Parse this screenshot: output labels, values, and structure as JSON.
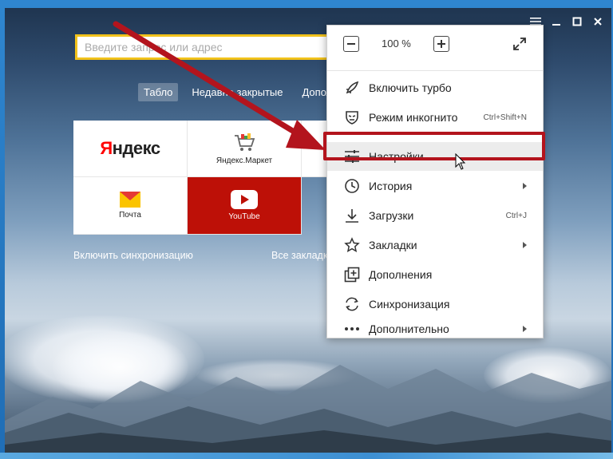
{
  "search": {
    "placeholder": "Введите запрос или адрес"
  },
  "tabs": [
    {
      "label": "Табло",
      "active": true
    },
    {
      "label": "Недавно закрытые",
      "active": false
    },
    {
      "label": "Дополнения",
      "active": false
    }
  ],
  "tiles": [
    {
      "label": "Яндекс",
      "kind": "logo"
    },
    {
      "label": "Яндекс.Маркет",
      "kind": "market"
    },
    {
      "label": "Почта",
      "kind": "mail"
    },
    {
      "label": "YouTube",
      "kind": "youtube"
    }
  ],
  "links": {
    "sync": "Включить синхронизацию",
    "all_bookmarks": "Все закладки"
  },
  "menu": {
    "zoom": {
      "value": "100 %",
      "minus_icon": "minus-icon",
      "plus_icon": "plus-icon",
      "fullscreen_icon": "fullscreen-icon"
    },
    "items": [
      {
        "label": "Включить турбо",
        "icon": "rocket-icon",
        "shortcut": "",
        "submenu": false
      },
      {
        "label": "Режим инкогнито",
        "icon": "incognito-mask-icon",
        "shortcut": "Ctrl+Shift+N",
        "submenu": false
      },
      {
        "label": "Настройки",
        "icon": "settings-sliders-icon",
        "shortcut": "",
        "submenu": false,
        "highlighted": true
      },
      {
        "label": "История",
        "icon": "clock-icon",
        "shortcut": "",
        "submenu": true
      },
      {
        "label": "Загрузки",
        "icon": "download-icon",
        "shortcut": "Ctrl+J",
        "submenu": false
      },
      {
        "label": "Закладки",
        "icon": "star-icon",
        "shortcut": "",
        "submenu": true
      },
      {
        "label": "Дополнения",
        "icon": "extensions-icon",
        "shortcut": "",
        "submenu": false
      },
      {
        "label": "Синхронизация",
        "icon": "sync-icon",
        "shortcut": "",
        "submenu": false
      },
      {
        "label": "Дополнительно",
        "icon": "more-dots-icon",
        "shortcut": "",
        "submenu": true
      }
    ]
  },
  "colors": {
    "highlight_frame": "#b3141d",
    "arrow": "#b3141d",
    "search_border": "#f2c21b",
    "youtube": "#bd1007"
  }
}
